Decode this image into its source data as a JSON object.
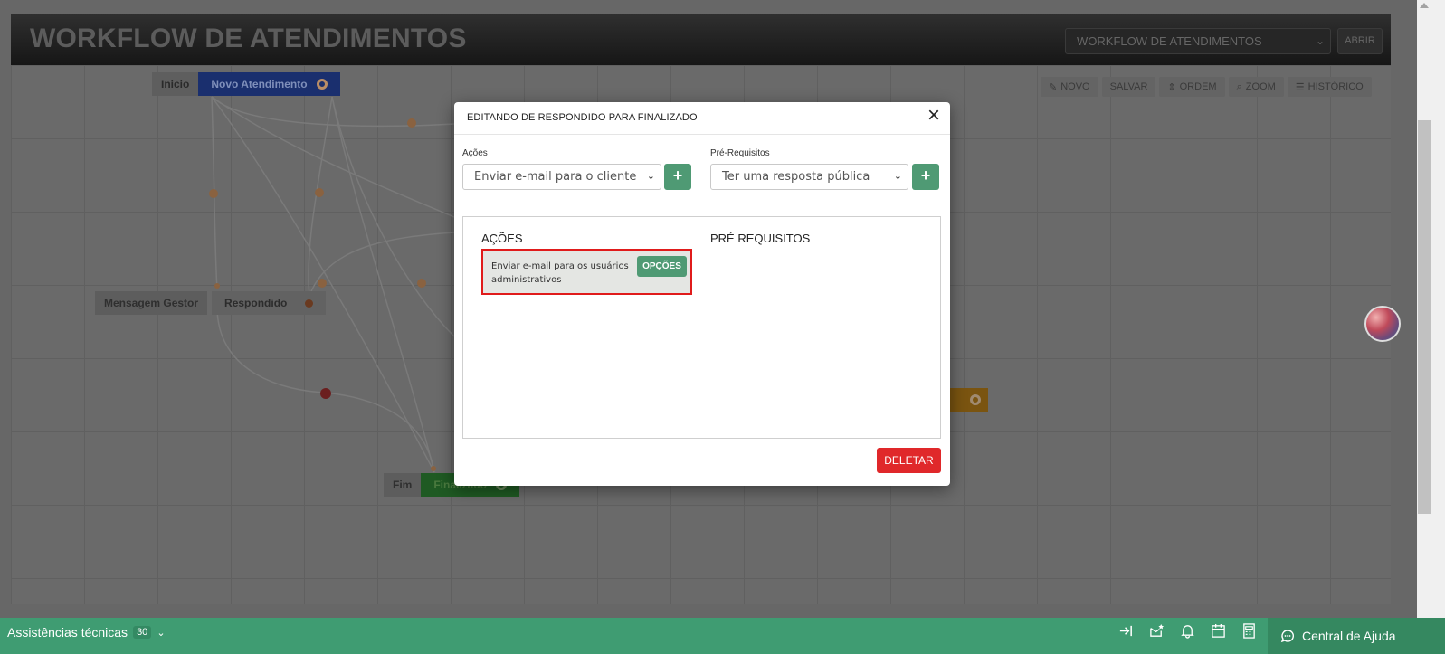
{
  "app": {
    "title": "WORKFLOW DE ATENDIMENTOS",
    "workflow_select": "WORKFLOW DE ATENDIMENTOS",
    "abrir_label": "ABRIR",
    "toolbar": [
      {
        "label": "NOVO",
        "icon": "pencil-icon"
      },
      {
        "label": "SALVAR",
        "icon": ""
      },
      {
        "label": "ORDEM",
        "icon": "sort-icon"
      },
      {
        "label": "ZOOM",
        "icon": "search-icon"
      },
      {
        "label": "HISTÓRICO",
        "icon": "list-icon"
      }
    ]
  },
  "nodes": {
    "inicio": "Inicio",
    "novo_atendimento": "Novo Atendimento",
    "mensagem_gestor": "Mensagem Gestor",
    "respondido": "Respondido",
    "fim": "Fim",
    "finalizado": "Finalizado"
  },
  "modal": {
    "title": "EDITANDO DE RESPONDIDO PARA FINALIZADO",
    "acoes_label": "Ações",
    "acoes_select": "Enviar e-mail para o cliente",
    "prereq_label": "Pré-Requisitos",
    "prereq_select": "Ter uma resposta pública",
    "panel_acoes_head": "AÇÕES",
    "panel_prereq_head": "PRÉ REQUISITOS",
    "action_item_text": "Enviar e-mail para os usuários administrativos",
    "opcoes_label": "OPÇÕES",
    "deletar_label": "DELETAR",
    "colors": {
      "green": "#4f9a74",
      "red": "#e0282a",
      "highlight": "#e01b1b"
    }
  },
  "bottom": {
    "label": "Assistências técnicas",
    "count": "30",
    "help_label": "Central de Ajuda",
    "icons": [
      "sign-in-icon",
      "mail-star-icon",
      "bell-icon",
      "calendar-icon",
      "calculator-icon"
    ]
  }
}
